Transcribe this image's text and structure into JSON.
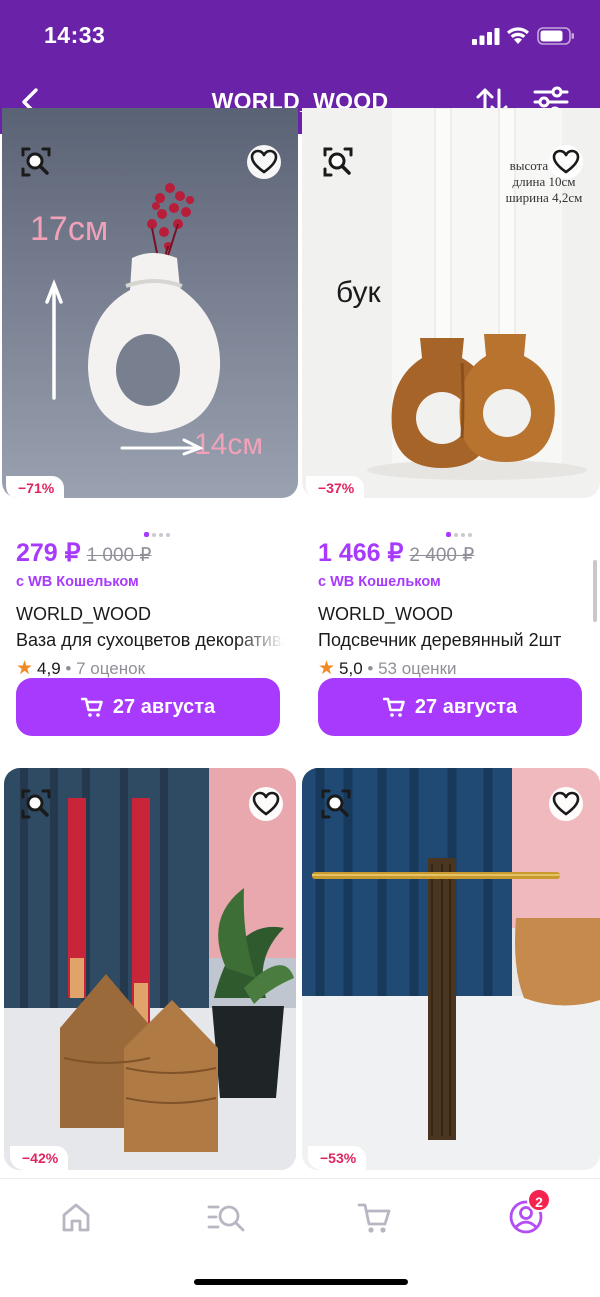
{
  "status": {
    "time": "14:33"
  },
  "header": {
    "title": "WORLD_WOOD"
  },
  "products": [
    {
      "discount": "−71%",
      "price": "279 ₽",
      "old_price": "1 000 ₽",
      "wallet": "с WB Кошельком",
      "brand": "WORLD_WOOD",
      "name": "Ваза для сухоцветов декоративная",
      "rating": "4,9",
      "reviews": "7 оценок",
      "delivery": "27 августа",
      "photo_text": {
        "a": "17см",
        "b": "14см"
      }
    },
    {
      "discount": "−37%",
      "price": "1 466 ₽",
      "old_price": "2 400 ₽",
      "wallet": "с WB Кошельком",
      "brand": "WORLD_WOOD",
      "name": "Подсвечник деревянный 2шт",
      "rating": "5,0",
      "reviews": "53 оценки",
      "delivery": "27 августа",
      "photo_text": {
        "material": "бук",
        "h": "высота 12см",
        "l": "длина 10см",
        "w": "ширина 4,2см"
      }
    },
    {
      "discount": "−42%"
    },
    {
      "discount": "−53%"
    }
  ],
  "tabs": {
    "cart_badge": "2"
  },
  "colors": {
    "header": "#6a23a8",
    "accent": "#a73afd",
    "discount": "#e0245e",
    "badge": "#f5244f"
  }
}
